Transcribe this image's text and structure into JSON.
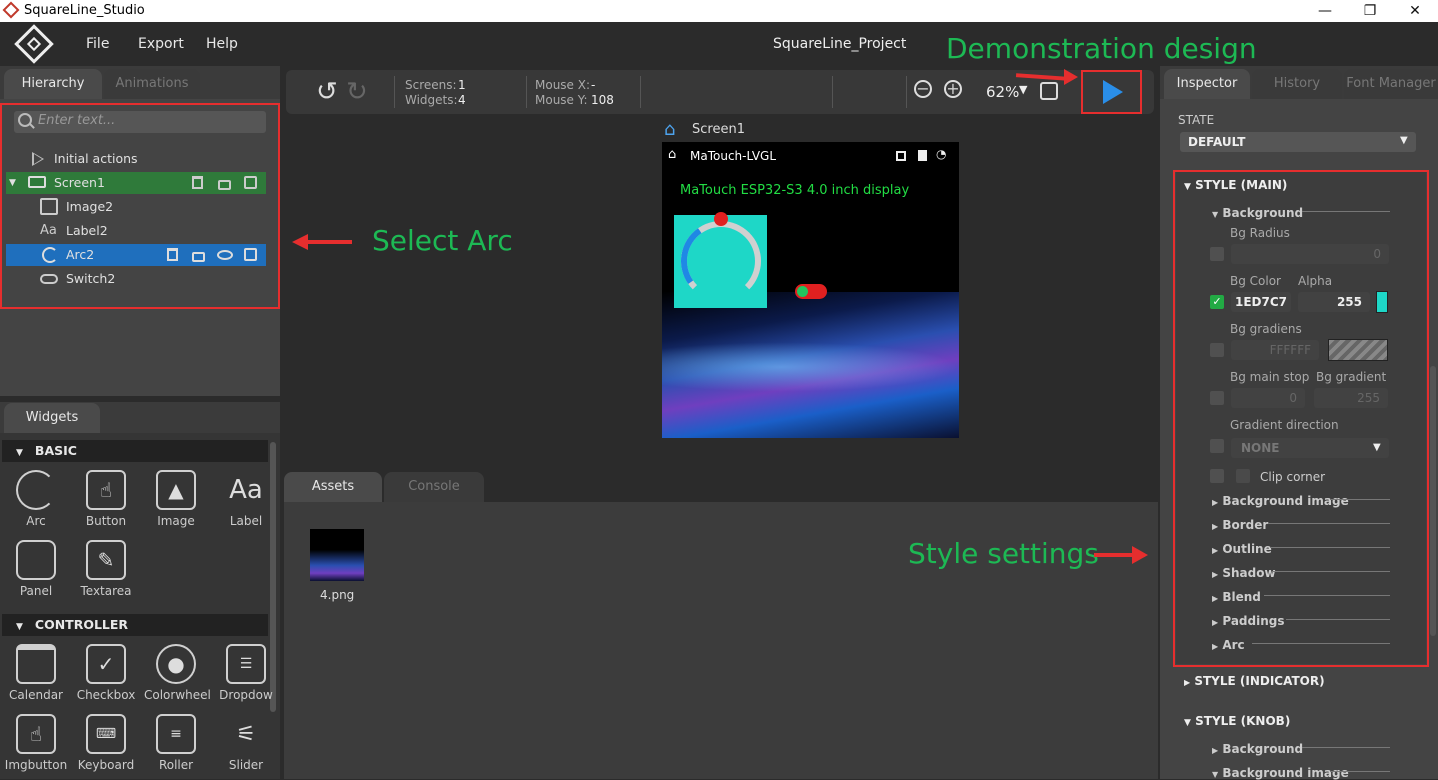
{
  "app": {
    "title": "SquareLine_Studio",
    "project_name": "SquareLine_Project"
  },
  "window_controls": {
    "minimize": "—",
    "maximize": "❐",
    "close": "✕"
  },
  "menu": [
    "File",
    "Export",
    "Help"
  ],
  "hierarchy": {
    "tabs": [
      "Hierarchy",
      "Animations"
    ],
    "search_placeholder": "Enter text...",
    "items": [
      {
        "label": "Initial actions"
      },
      {
        "label": "Screen1"
      },
      {
        "label": "Image2"
      },
      {
        "label": "Label2"
      },
      {
        "label": "Arc2"
      },
      {
        "label": "Switch2"
      }
    ]
  },
  "widgets": {
    "tab": "Widgets",
    "sections": [
      {
        "title": "BASIC",
        "items": [
          "Arc",
          "Button",
          "Image",
          "Label",
          "Panel",
          "Textarea"
        ]
      },
      {
        "title": "CONTROLLER",
        "items": [
          "Calendar",
          "Checkbox",
          "Colorwheel",
          "Dropdow",
          "Imgbutton",
          "Keyboard",
          "Roller",
          "Slider"
        ]
      }
    ]
  },
  "toolbar": {
    "screens_label": "Screens:",
    "screens_value": "1",
    "widgets_label": "Widgets:",
    "widgets_value": "4",
    "mouse_x_label": "Mouse X:",
    "mouse_x_value": "-",
    "mouse_y_label": "Mouse Y:",
    "mouse_y_value": "108",
    "zoom": "62%"
  },
  "canvas": {
    "screen_name": "Screen1",
    "device_title": "MaTouch-LVGL",
    "device_label": "MaTouch ESP32-S3 4.0 inch display"
  },
  "bottom": {
    "tabs": [
      "Assets",
      "Console"
    ],
    "asset_name": "4.png"
  },
  "inspector": {
    "tabs": [
      "Inspector",
      "History",
      "Font Manager"
    ],
    "state_label": "STATE",
    "state_value": "DEFAULT",
    "style_main": "STYLE (MAIN)",
    "background": "Background",
    "bg_radius_label": "Bg Radius",
    "bg_radius_value": "0",
    "bg_color_label": "Bg Color",
    "alpha_label": "Alpha",
    "bg_color_value": "1ED7C7",
    "alpha_value": "255",
    "bg_gradiens_label": "Bg gradiens",
    "bg_gradiens_value": "FFFFFF",
    "bg_main_stop_label": "Bg main stop",
    "bg_main_stop_value": "0",
    "bg_gradient_label": "Bg gradient",
    "bg_gradient_value": "255",
    "gradient_direction_label": "Gradient direction",
    "gradient_direction_value": "NONE",
    "clip_corner_label": "Clip corner",
    "subsections": [
      "Background image",
      "Border",
      "Outline",
      "Shadow",
      "Blend",
      "Paddings",
      "Arc"
    ],
    "style_indicator": "STYLE (INDICATOR)",
    "style_knob": "STYLE (KNOB)",
    "knob_background": "Background",
    "knob_background_image": "Background image"
  },
  "annotations": {
    "demo": "Demonstration design",
    "select_arc": "Select Arc",
    "style_settings": "Style settings"
  },
  "colors": {
    "accent_green": "#1db954",
    "selection_blue": "#1f6fbd",
    "screen_green": "#2f7a3a",
    "bg_color": "#1ED7C7",
    "annotation_red": "#e62e2e"
  }
}
